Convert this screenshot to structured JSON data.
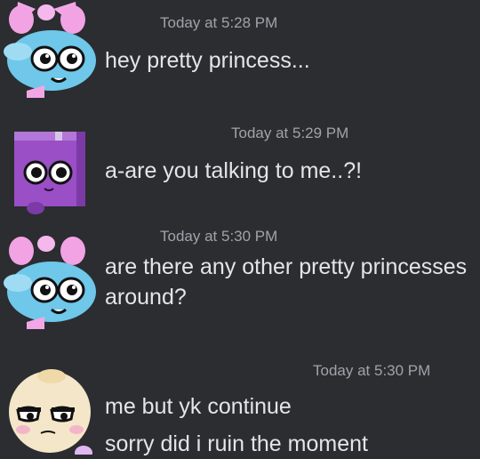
{
  "messages": [
    {
      "avatar": "blue-girl-pink-bow-avatar",
      "timestamp": "Today at 5:28 PM",
      "lines": [
        "hey pretty princess..."
      ]
    },
    {
      "avatar": "purple-box-avatar",
      "timestamp": "Today at 5:29 PM",
      "lines": [
        "a-are you talking to me..?!"
      ]
    },
    {
      "avatar": "blue-girl-pink-bow-avatar",
      "timestamp": "Today at 5:30 PM",
      "lines": [
        "are there any other pretty princesses",
        "around?"
      ]
    },
    {
      "avatar": "cream-character-avatar",
      "timestamp": "Today at 5:30 PM",
      "lines": [
        "me but yk continue",
        "sorry did i ruin the moment"
      ]
    }
  ],
  "colors": {
    "background": "#2b2d31",
    "text": "#e3e5e8",
    "timestamp": "#9fa3aa"
  }
}
